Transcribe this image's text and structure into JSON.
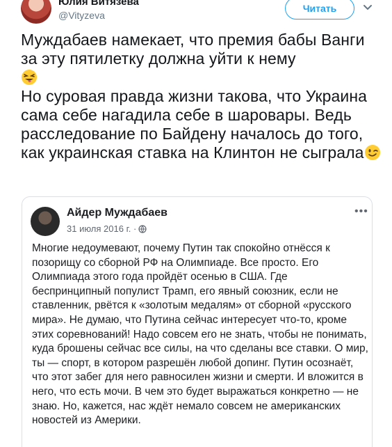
{
  "author": {
    "name": "Юлия Витязева",
    "handle": "@Vityzeva"
  },
  "follow_button": {
    "label": "Читать"
  },
  "tweet": {
    "line1": "Муждабаев намекает, что премия бабы Ванги за эту пятилетку должна уйти к нему",
    "emoji1": "tongue-wink-emoji",
    "paragraph2": "Но суровая правда жизни такова, что Украина сама себе нагадила себе в шаровары. Ведь расследование по Байдену началось до того, как украинская ставка на Клинтон не сыграла",
    "emoji2": "winking-face-emoji"
  },
  "quoted_post": {
    "author": "Айдер Муждабаев",
    "date": "31 июля 2016 г. ·",
    "more": "•••",
    "text": "Многие недоумевают, почему Путин так спокойно отнёсся к позорищу со сборной РФ на Олимпиаде. Все просто. Его Олимпиада этого года пройдёт осенью в США. Где беспринципный популист Трамп, его явный союзник, если не ставленник, рвётся к «золотым медалям» от сборной «русского мира». Не думаю, что Путина сейчас интересует что-то, кроме этих соревнований! Надо совсем его не знать, чтобы не понимать, куда брошены сейчас все силы, на что сделаны все ставки. О мир, ты — спорт, в котором разрешён любой допинг. Путин осознаёт, что этот забег для него равносилен жизни и смерти. И вложится в него, что есть мочи. В чем это будет выражаться конкретно — не знаю. Но, кажется, нас ждёт немало совсем не американских новостей из Америки."
  },
  "colors": {
    "accent": "#1da1f2",
    "text": "#14171a",
    "muted": "#657786"
  }
}
